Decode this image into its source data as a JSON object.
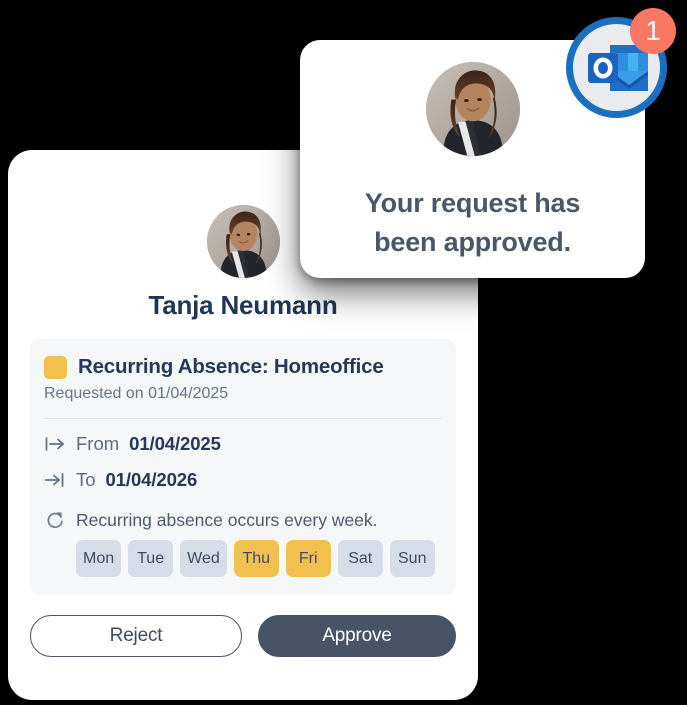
{
  "notification": {
    "message_line_1": "Your request has",
    "message_line_2": "been approved.",
    "avatar_alt": "Tanja Neumann avatar",
    "app_icon": "outlook-icon",
    "badge_count": "1",
    "badge_color": "#F97863",
    "ring_color": "#1B6FC1"
  },
  "request": {
    "employee_name": "Tanja Neumann",
    "avatar_alt": "Tanja Neumann avatar",
    "type_swatch_color": "#F2C04F",
    "absence_title": "Recurring Absence: Homeoffice",
    "requested_on": "Requested on 01/04/2025",
    "from": {
      "icon": "arrow-from-icon",
      "label": "From",
      "value": "01/04/2025"
    },
    "to": {
      "icon": "arrow-to-icon",
      "label": "To",
      "value": "01/04/2026"
    },
    "recurrence": {
      "icon": "refresh-icon",
      "text": "Recurring absence occurs every week.",
      "days": [
        {
          "label": "Mon",
          "active": false
        },
        {
          "label": "Tue",
          "active": false
        },
        {
          "label": "Wed",
          "active": false
        },
        {
          "label": "Thu",
          "active": true
        },
        {
          "label": "Fri",
          "active": true
        },
        {
          "label": "Sat",
          "active": false
        },
        {
          "label": "Sun",
          "active": false
        }
      ]
    },
    "actions": {
      "reject_label": "Reject",
      "approve_label": "Approve"
    }
  }
}
